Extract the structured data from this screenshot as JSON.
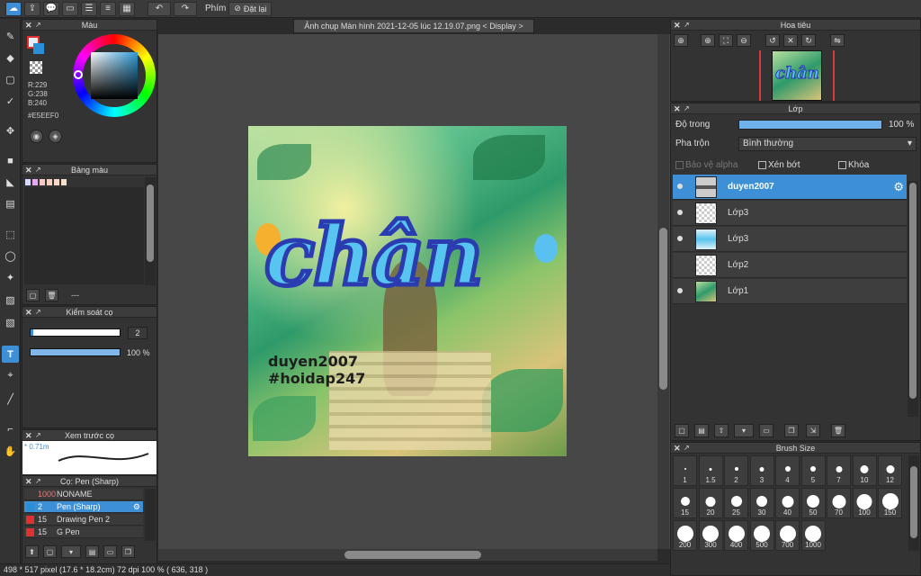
{
  "toolbar": {
    "shortcut_label": "Phím",
    "reset_label": "Đặt lại"
  },
  "document": {
    "tab_title": "Ảnh chụp Màn hình 2021-12-05 lúc 12.19.07.png < Display >"
  },
  "color_panel": {
    "title": "Màu",
    "r": "R:229",
    "g": "G:238",
    "b": "B:240",
    "hex": "#E5EEF0",
    "foreground": "#e5eef0",
    "background": "#2a8fd6"
  },
  "palette_panel": {
    "title": "Bảng màu",
    "swatches": [
      "#d9d9ff",
      "#e8a8f0",
      "#f6c8c8",
      "#f8d0c0",
      "#f8d8c8",
      "#f8e0c8"
    ],
    "name_placeholder": "---"
  },
  "brush_control": {
    "title": "Kiểm soát cọ",
    "size_value": "2",
    "opacity_value": "100 %"
  },
  "preview_panel": {
    "title": "Xem trước cọ",
    "size_label": "* 0.71m"
  },
  "brush_list": {
    "title": "Cọ: Pen (Sharp)",
    "items": [
      {
        "size": "1000",
        "name": "NONAME",
        "color": "#3a3a3a"
      },
      {
        "size": "2",
        "name": "Pen (Sharp)",
        "color": "#2a8fd6"
      },
      {
        "size": "15",
        "name": "Drawing Pen 2",
        "color": "#e03030"
      },
      {
        "size": "15",
        "name": "G Pen",
        "color": "#e03030"
      }
    ]
  },
  "artwork": {
    "word": "chân",
    "caption_1": "duyen2007",
    "caption_2": "#hoidap247"
  },
  "status": {
    "text": "498 * 517 pixel  (17.6 * 18.2cm)  72 dpi  100 %  ( 636, 318 )"
  },
  "navigator": {
    "title": "Hoa tiêu"
  },
  "layer_panel": {
    "title": "Lớp",
    "opacity_label": "Độ trong",
    "opacity_value": "100 %",
    "opacity_level": 1.0,
    "blend_label": "Pha trộn",
    "blend_value": "Bình thường",
    "protect_alpha": "Bảo vệ alpha",
    "clipping": "Xén bớt",
    "lock": "Khóa",
    "layers": [
      {
        "name": "duyen2007",
        "selected": true
      },
      {
        "name": "Lớp3",
        "selected": false
      },
      {
        "name": "Lớp3",
        "selected": false
      },
      {
        "name": "Lớp2",
        "selected": false
      },
      {
        "name": "Lớp1",
        "selected": false
      }
    ]
  },
  "brush_size": {
    "title": "Brush Size",
    "sizes": [
      "1",
      "1.5",
      "2",
      "3",
      "4",
      "5",
      "7",
      "10",
      "12",
      "15",
      "20",
      "25",
      "30",
      "40",
      "50",
      "70",
      "100",
      "150",
      "200",
      "300",
      "400",
      "500",
      "700",
      "1000"
    ]
  }
}
